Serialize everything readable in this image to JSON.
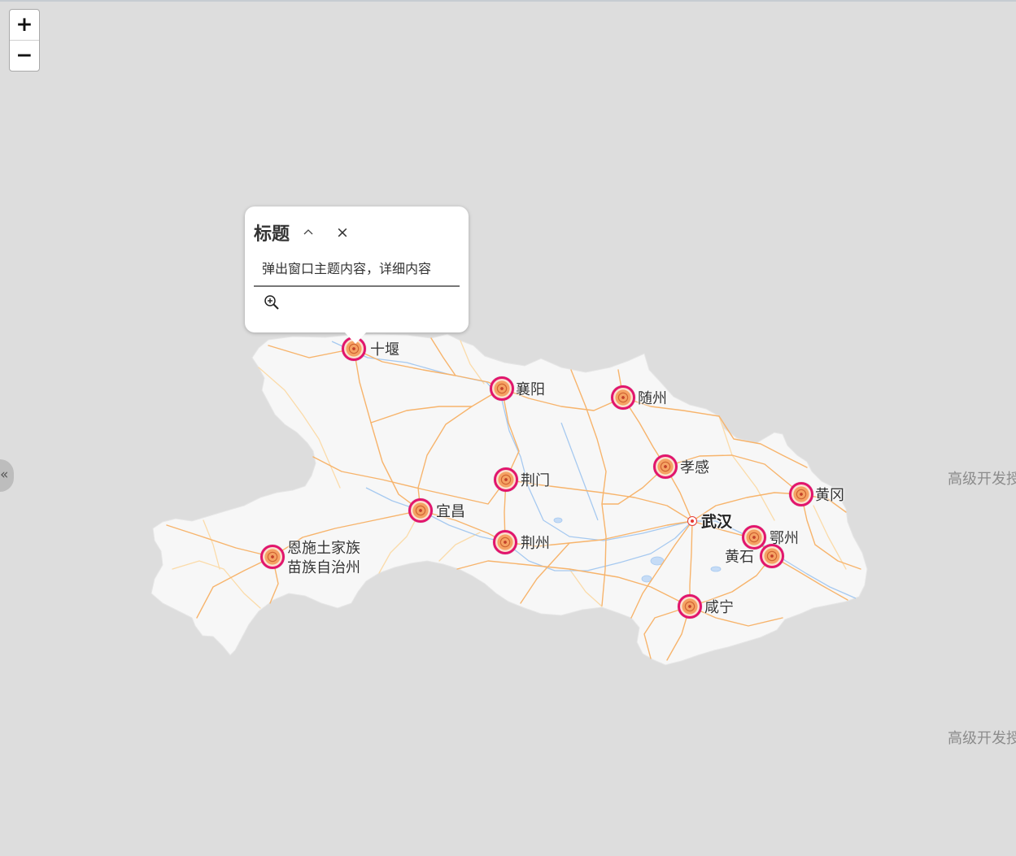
{
  "map_controls": {
    "zoom_in_label": "+",
    "zoom_out_label": "−",
    "zoom_in_icon": "plus-icon",
    "zoom_out_icon": "minus-icon"
  },
  "side_panel_toggle": {
    "label": "«",
    "icon": "double-chevron-left-icon"
  },
  "popup": {
    "title": "标题",
    "collapse_icon": "chevron-up-icon",
    "close_label": "×",
    "close_icon": "close-icon",
    "content": "弹出窗口主题内容，详细内容",
    "zoom_icon": "zoom-in-icon"
  },
  "map": {
    "marker_icon": "poi-marker-icon",
    "cities": [
      {
        "name": "十堰"
      },
      {
        "name": "襄阳"
      },
      {
        "name": "随州"
      },
      {
        "name": "孝感"
      },
      {
        "name": "荆门"
      },
      {
        "name": "宜昌"
      },
      {
        "name": "黄冈"
      },
      {
        "name": "鄂州"
      },
      {
        "name": "黄石"
      },
      {
        "name": "荆州"
      },
      {
        "name_lines": [
          "恩施土家族",
          "苗族自治州"
        ]
      },
      {
        "name": "咸宁"
      }
    ],
    "capital": {
      "name": "武汉",
      "icon": "capital-target-icon"
    }
  },
  "watermarks": [
    {
      "text": "高级开发授"
    },
    {
      "text": "高级开发授"
    }
  ],
  "colors": {
    "background": "#dddddd",
    "province_fill": "#f7f7f7",
    "road": "#f7b46c",
    "road_minor": "#fbdba9",
    "river": "#a6c9f0",
    "marker_ring": "#e2156d",
    "marker_fill": "#f5a263",
    "label_text": "#333333",
    "capital_icon": "#e53935",
    "watermark_text": "#8c8c8c"
  }
}
